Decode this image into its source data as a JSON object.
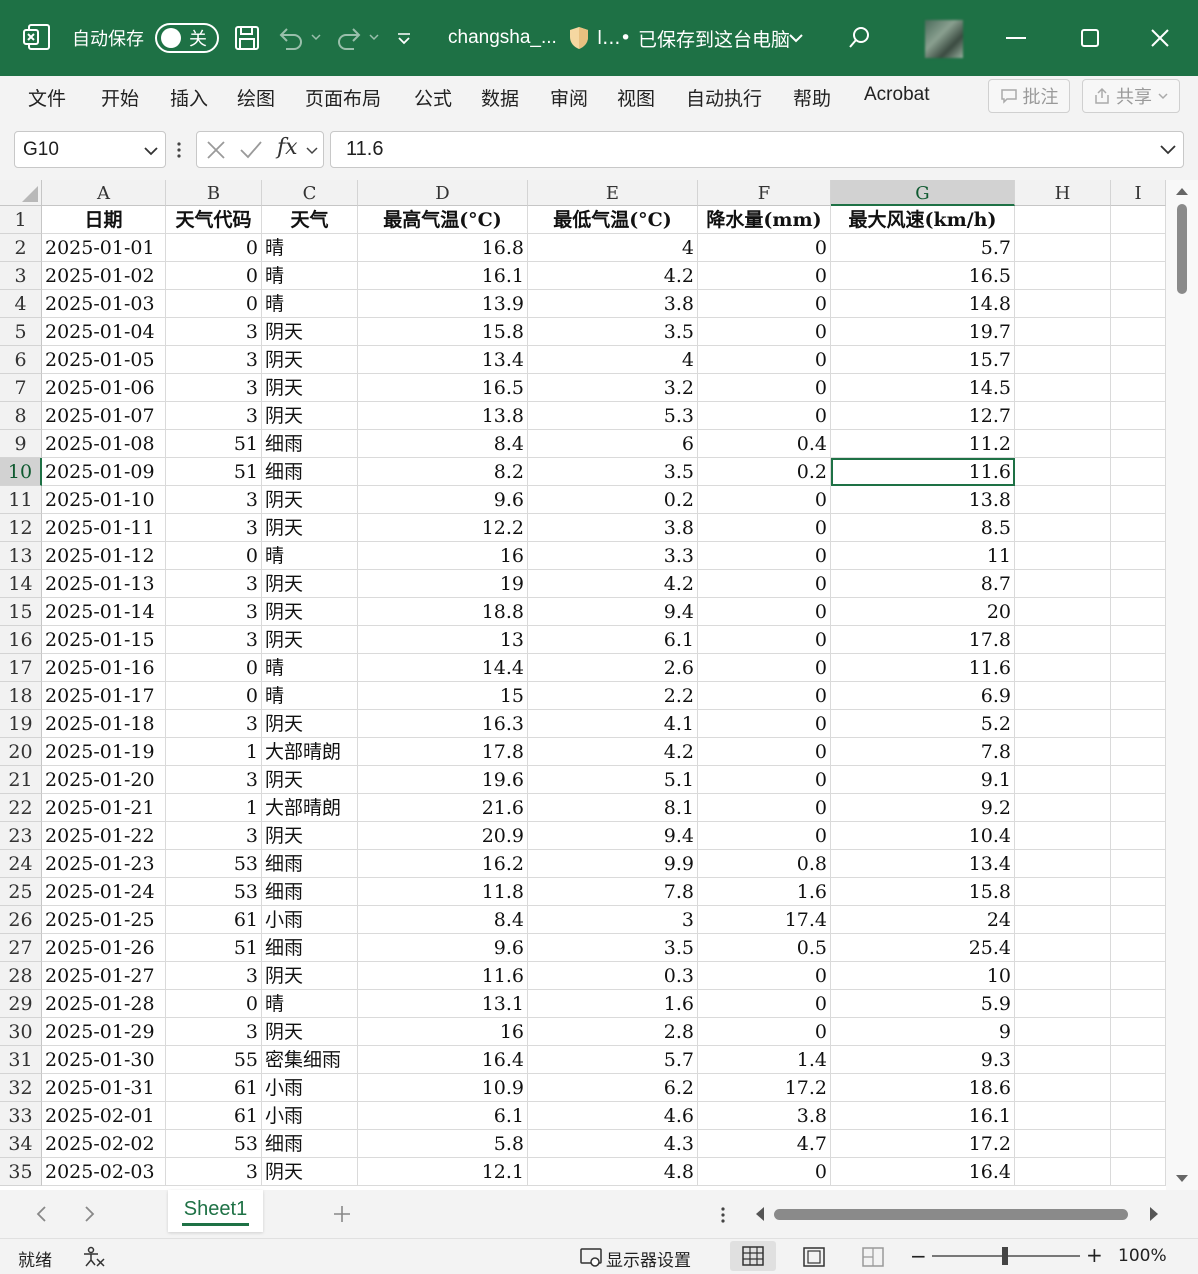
{
  "titlebar": {
    "autosave_label": "自动保存",
    "autosave_state": "关",
    "filename": "changsha_...",
    "sensitivity_short": "l...",
    "save_status": "已保存到这台电脑",
    "bg_color": "#1e7145"
  },
  "menu": [
    "文件",
    "开始",
    "插入",
    "绘图",
    "页面布局",
    "公式",
    "数据",
    "审阅",
    "视图",
    "自动执行",
    "帮助",
    "Acrobat"
  ],
  "ribbon_right": {
    "comment_label": "批注",
    "share_label": "共享"
  },
  "formula_bar": {
    "name_box": "G10",
    "fx": "fx",
    "formula": "11.6"
  },
  "columns": [
    "A",
    "B",
    "C",
    "D",
    "E",
    "F",
    "G",
    "H",
    "I"
  ],
  "selected_col": "G",
  "selected_row": "10",
  "header_row": [
    "日期",
    "天气代码",
    "天气",
    "最高气温(°C)",
    "最低气温(°C)",
    "降水量(mm)",
    "最大风速(km/h)"
  ],
  "rows": [
    [
      "2",
      "2025-01-01",
      "0",
      "晴",
      "16.8",
      "4",
      "0",
      "5.7"
    ],
    [
      "3",
      "2025-01-02",
      "0",
      "晴",
      "16.1",
      "4.2",
      "0",
      "16.5"
    ],
    [
      "4",
      "2025-01-03",
      "0",
      "晴",
      "13.9",
      "3.8",
      "0",
      "14.8"
    ],
    [
      "5",
      "2025-01-04",
      "3",
      "阴天",
      "15.8",
      "3.5",
      "0",
      "19.7"
    ],
    [
      "6",
      "2025-01-05",
      "3",
      "阴天",
      "13.4",
      "4",
      "0",
      "15.7"
    ],
    [
      "7",
      "2025-01-06",
      "3",
      "阴天",
      "16.5",
      "3.2",
      "0",
      "14.5"
    ],
    [
      "8",
      "2025-01-07",
      "3",
      "阴天",
      "13.8",
      "5.3",
      "0",
      "12.7"
    ],
    [
      "9",
      "2025-01-08",
      "51",
      "细雨",
      "8.4",
      "6",
      "0.4",
      "11.2"
    ],
    [
      "10",
      "2025-01-09",
      "51",
      "细雨",
      "8.2",
      "3.5",
      "0.2",
      "11.6"
    ],
    [
      "11",
      "2025-01-10",
      "3",
      "阴天",
      "9.6",
      "0.2",
      "0",
      "13.8"
    ],
    [
      "12",
      "2025-01-11",
      "3",
      "阴天",
      "12.2",
      "3.8",
      "0",
      "8.5"
    ],
    [
      "13",
      "2025-01-12",
      "0",
      "晴",
      "16",
      "3.3",
      "0",
      "11"
    ],
    [
      "14",
      "2025-01-13",
      "3",
      "阴天",
      "19",
      "4.2",
      "0",
      "8.7"
    ],
    [
      "15",
      "2025-01-14",
      "3",
      "阴天",
      "18.8",
      "9.4",
      "0",
      "20"
    ],
    [
      "16",
      "2025-01-15",
      "3",
      "阴天",
      "13",
      "6.1",
      "0",
      "17.8"
    ],
    [
      "17",
      "2025-01-16",
      "0",
      "晴",
      "14.4",
      "2.6",
      "0",
      "11.6"
    ],
    [
      "18",
      "2025-01-17",
      "0",
      "晴",
      "15",
      "2.2",
      "0",
      "6.9"
    ],
    [
      "19",
      "2025-01-18",
      "3",
      "阴天",
      "16.3",
      "4.1",
      "0",
      "5.2"
    ],
    [
      "20",
      "2025-01-19",
      "1",
      "大部晴朗",
      "17.8",
      "4.2",
      "0",
      "7.8"
    ],
    [
      "21",
      "2025-01-20",
      "3",
      "阴天",
      "19.6",
      "5.1",
      "0",
      "9.1"
    ],
    [
      "22",
      "2025-01-21",
      "1",
      "大部晴朗",
      "21.6",
      "8.1",
      "0",
      "9.2"
    ],
    [
      "23",
      "2025-01-22",
      "3",
      "阴天",
      "20.9",
      "9.4",
      "0",
      "10.4"
    ],
    [
      "24",
      "2025-01-23",
      "53",
      "细雨",
      "16.2",
      "9.9",
      "0.8",
      "13.4"
    ],
    [
      "25",
      "2025-01-24",
      "53",
      "细雨",
      "11.8",
      "7.8",
      "1.6",
      "15.8"
    ],
    [
      "26",
      "2025-01-25",
      "61",
      "小雨",
      "8.4",
      "3",
      "17.4",
      "24"
    ],
    [
      "27",
      "2025-01-26",
      "51",
      "细雨",
      "9.6",
      "3.5",
      "0.5",
      "25.4"
    ],
    [
      "28",
      "2025-01-27",
      "3",
      "阴天",
      "11.6",
      "0.3",
      "0",
      "10"
    ],
    [
      "29",
      "2025-01-28",
      "0",
      "晴",
      "13.1",
      "1.6",
      "0",
      "5.9"
    ],
    [
      "30",
      "2025-01-29",
      "3",
      "阴天",
      "16",
      "2.8",
      "0",
      "9"
    ],
    [
      "31",
      "2025-01-30",
      "55",
      "密集细雨",
      "16.4",
      "5.7",
      "1.4",
      "9.3"
    ],
    [
      "32",
      "2025-01-31",
      "61",
      "小雨",
      "10.9",
      "6.2",
      "17.2",
      "18.6"
    ],
    [
      "33",
      "2025-02-01",
      "61",
      "小雨",
      "6.1",
      "4.6",
      "3.8",
      "16.1"
    ],
    [
      "34",
      "2025-02-02",
      "53",
      "细雨",
      "5.8",
      "4.3",
      "4.7",
      "17.2"
    ],
    [
      "35",
      "2025-02-03",
      "3",
      "阴天",
      "12.1",
      "4.8",
      "0",
      "16.4"
    ]
  ],
  "sheet_tab": "Sheet1",
  "status": {
    "ready": "就绪",
    "display_settings": "显示器设置",
    "zoom": "100%"
  }
}
